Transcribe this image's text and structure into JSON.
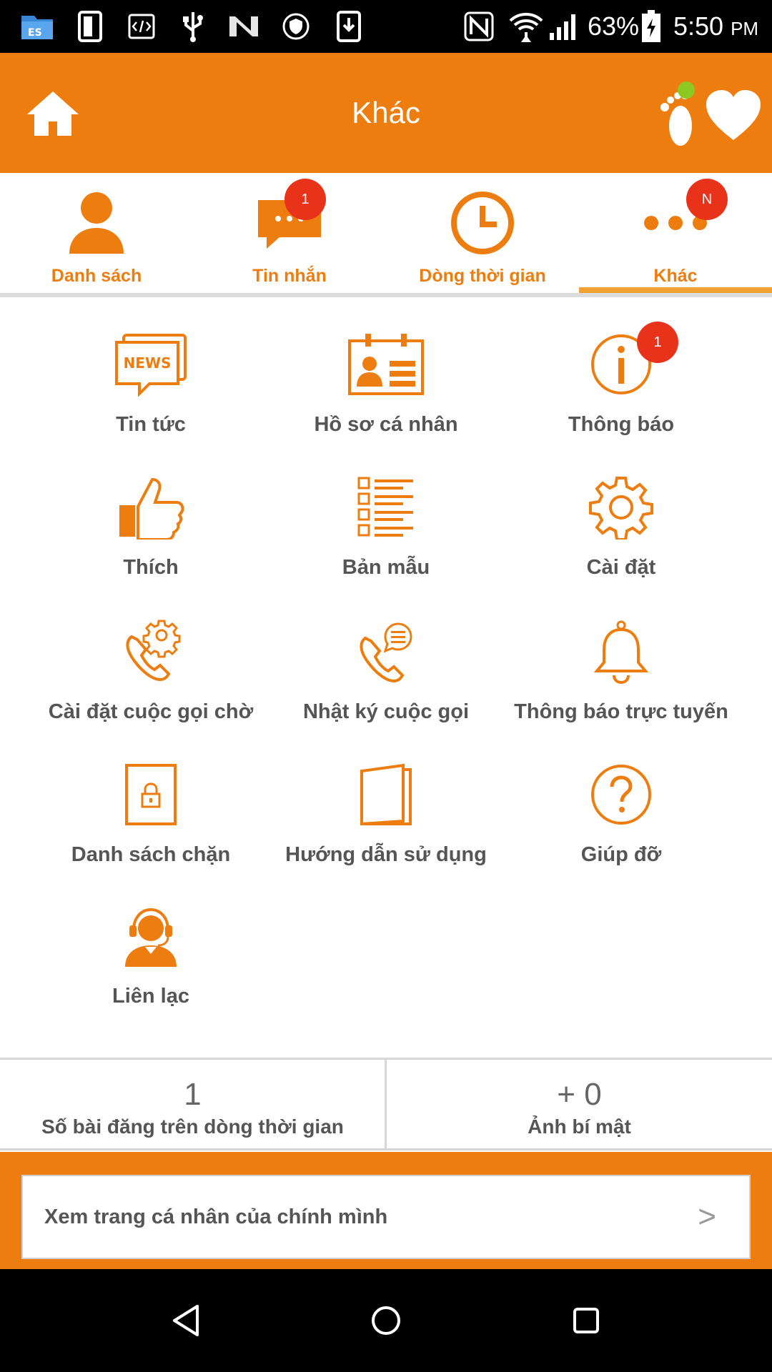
{
  "status_bar": {
    "battery": "63%",
    "time": "5:50",
    "ampm": "PM",
    "icons": [
      "file-manager-icon",
      "phone-device-icon",
      "code-icon",
      "usb-icon",
      "n-logo-icon",
      "shield-icon",
      "download-icon",
      "nfc-icon",
      "wifi-icon",
      "signal-icon",
      "battery-icon"
    ]
  },
  "app_bar": {
    "title": "Khác",
    "icons": [
      "home-icon",
      "footprint-icon",
      "heart-icon"
    ]
  },
  "tabs": [
    {
      "label": "Danh sách",
      "icon": "person-icon",
      "badge": ""
    },
    {
      "label": "Tin nhắn",
      "icon": "chat-icon",
      "badge": "1"
    },
    {
      "label": "Dòng thời gian",
      "icon": "clock-icon",
      "badge": ""
    },
    {
      "label": "Khác",
      "icon": "more-icon",
      "badge": "N",
      "active": true
    }
  ],
  "menu": [
    {
      "label": "Tin tức",
      "icon": "news-icon",
      "icon_text": "NEWS"
    },
    {
      "label": "Hồ sơ cá nhân",
      "icon": "profile-card-icon"
    },
    {
      "label": "Thông báo",
      "icon": "info-icon",
      "badge": "1"
    },
    {
      "label": "Thích",
      "icon": "thumbs-up-icon"
    },
    {
      "label": "Bản mẫu",
      "icon": "template-list-icon"
    },
    {
      "label": "Cài đặt",
      "icon": "gear-icon"
    },
    {
      "label": "Cài đặt cuộc gọi chờ",
      "icon": "phone-gear-icon"
    },
    {
      "label": "Nhật ký cuộc gọi",
      "icon": "phone-log-icon"
    },
    {
      "label": "Thông báo trực tuyến",
      "icon": "bell-icon"
    },
    {
      "label": "Danh sách chặn",
      "icon": "lock-door-icon"
    },
    {
      "label": "Hướng dẫn sử dụng",
      "icon": "book-icon"
    },
    {
      "label": "Giúp đỡ",
      "icon": "help-icon"
    },
    {
      "label": "Liên lạc",
      "icon": "support-agent-icon"
    }
  ],
  "stats": {
    "posts_count": "1",
    "posts_label": "Số bài đăng trên dòng thời gian",
    "secret_count": "+ 0",
    "secret_label": "Ảnh bí mật"
  },
  "profile_link": {
    "label": "Xem trang cá nhân của chính mình",
    "arrow": ">"
  },
  "nav_bar": {
    "icons": [
      "back-icon",
      "home-circle-icon",
      "recents-icon"
    ]
  },
  "colors": {
    "accent": "#ee7d0f",
    "badge": "#e8321a",
    "indicator": "#f0a232"
  }
}
